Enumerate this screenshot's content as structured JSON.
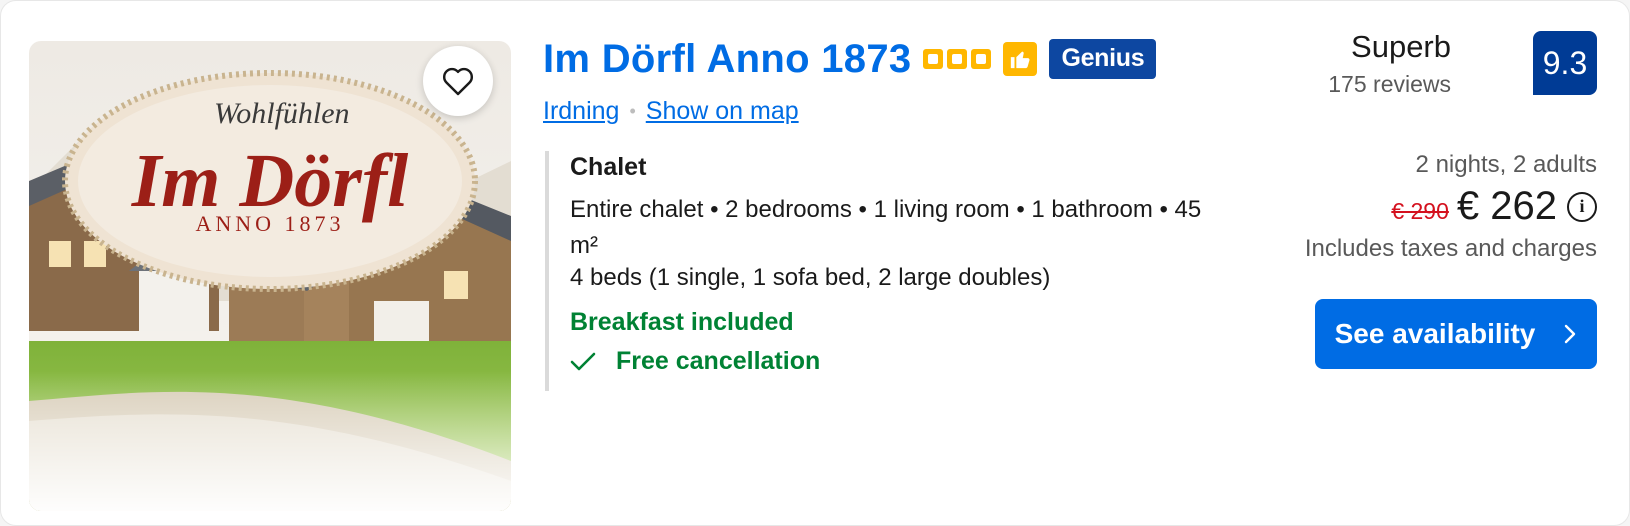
{
  "property": {
    "name": "Im Dörfl Anno 1873",
    "stars": 3,
    "badge": "Genius",
    "location": "Irdning",
    "map_link": "Show on map",
    "image": {
      "logo_script_top": "Wohlfühlen",
      "logo_script_main": "Im Dörfl",
      "logo_sub": "ANNO 1873"
    }
  },
  "unit": {
    "name": "Chalet",
    "description": "Entire chalet • 2 bedrooms • 1 living room • 1 bathroom • 45 m²",
    "beds": "4 beds (1 single, 1 sofa bed, 2 large doubles)",
    "breakfast": "Breakfast included",
    "cancellation": "Free cancellation"
  },
  "review": {
    "label": "Superb",
    "count": "175 reviews",
    "score": "9.3"
  },
  "pricing": {
    "stay": "2 nights, 2 adults",
    "old_price": "€ 290",
    "price": "€ 262",
    "note": "Includes taxes and charges",
    "cta": "See availability"
  },
  "colors": {
    "link": "#006ce4",
    "score_bg": "#003b95",
    "genius_bg": "#0d47a1",
    "star": "#ffb700",
    "green": "#008234",
    "strike": "#d4111e"
  },
  "icons": [
    "heart-icon",
    "star-icon",
    "thumbs-up-icon",
    "info-icon",
    "checkmark-icon",
    "chevron-right-icon"
  ]
}
